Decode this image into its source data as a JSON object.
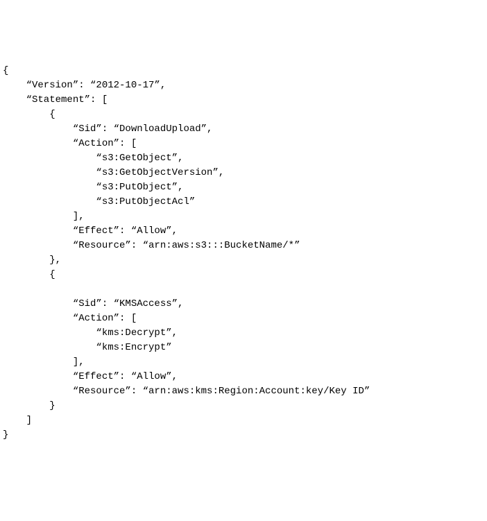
{
  "code": {
    "l01": "{",
    "l02": "    “Version”: “2012-10-17”,",
    "l03": "    “Statement”: [",
    "l04": "        {",
    "l05": "            “Sid”: “DownloadUpload”,",
    "l06": "            “Action”: [",
    "l07": "                “s3:GetObject”,",
    "l08": "                “s3:GetObjectVersion”,",
    "l09": "                “s3:PutObject”,",
    "l10": "                “s3:PutObjectAcl”",
    "l11": "            ],",
    "l12": "            “Effect”: “Allow”,",
    "l13": "            “Resource”: “arn:aws:s3:::BucketName/*”",
    "l14": "        },",
    "l15": "        {",
    "l16": "",
    "l17": "            “Sid”: “KMSAccess”,",
    "l18": "            “Action”: [",
    "l19": "                “kms:Decrypt”,",
    "l20": "                “kms:Encrypt”",
    "l21": "            ],",
    "l22": "            “Effect”: “Allow”,",
    "l23": "            “Resource”: “arn:aws:kms:Region:Account:key/Key ID”",
    "l24": "        }",
    "l25": "    ]",
    "l26": "}"
  }
}
